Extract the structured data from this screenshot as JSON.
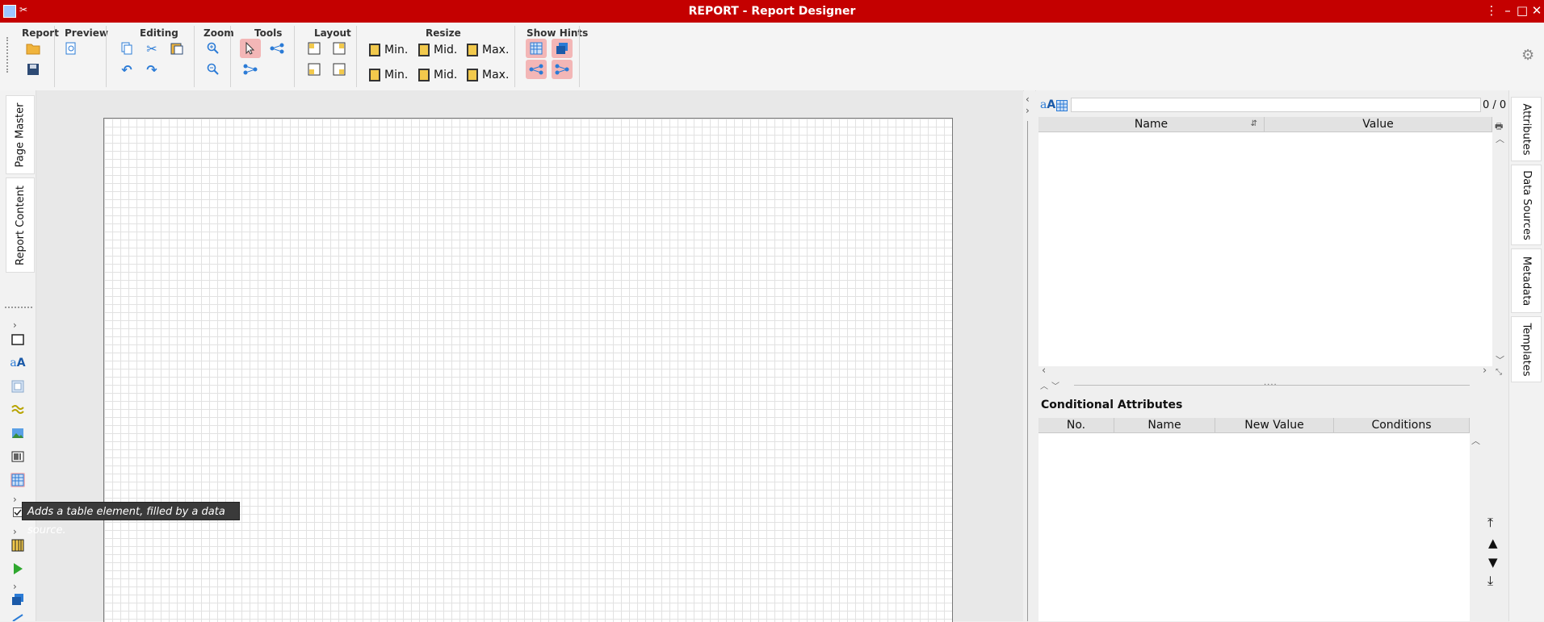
{
  "window": {
    "title": "REPORT - Report Designer"
  },
  "toolbar": {
    "groups": {
      "report": "Report",
      "preview": "Preview",
      "editing": "Editing",
      "zoom": "Zoom",
      "tools": "Tools",
      "layout": "Layout",
      "resize": "Resize",
      "show_hints": "Show Hints"
    },
    "resize": {
      "height_min": "Min.",
      "height_mid": "Mid.",
      "height_max": "Max.",
      "width_min": "Min.",
      "width_mid": "Mid.",
      "width_max": "Max."
    }
  },
  "left_tabs": {
    "page_master": "Page Master",
    "report_content": "Report Content"
  },
  "tooltip": {
    "text": "Adds a table element, filled by a data source."
  },
  "attributes": {
    "count": "0 / 0",
    "search_value": "",
    "columns": {
      "name": "Name",
      "value": "Value"
    },
    "sort_icon": "⇵"
  },
  "conditional": {
    "title": "Conditional Attributes",
    "columns": {
      "no": "No.",
      "name": "Name",
      "new_value": "New Value",
      "conditions": "Conditions"
    }
  },
  "right_tabs": {
    "attributes": "Attributes",
    "data_sources": "Data Sources",
    "metadata": "Metadata",
    "templates": "Templates"
  },
  "colors": {
    "title_bar": "#c40000",
    "active_tool": "#f3b6b6",
    "accent_blue": "#2b7bd6"
  }
}
